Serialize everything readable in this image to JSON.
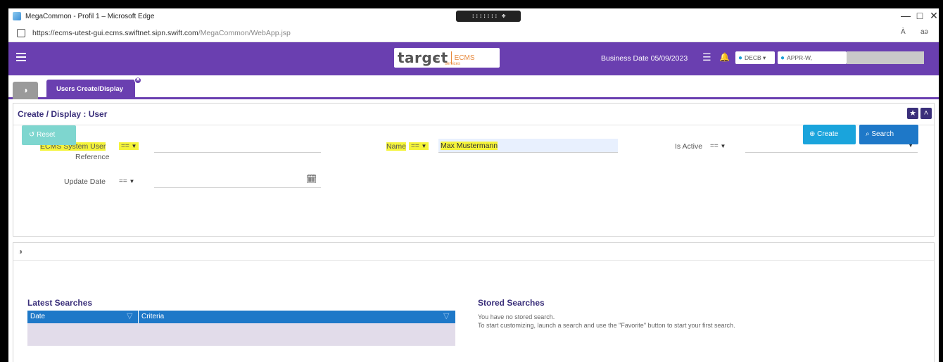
{
  "browser": {
    "title": "MegaCommon - Profil 1 – Microsoft Edge",
    "drag_handle": "::::::: ✥ :::::::",
    "url_host": "https://ecms-utest-gui.ecms.swiftnet.sipn.swift.com",
    "url_path": "/MegaCommon/WebApp.jsp",
    "minimize": "—",
    "maximize": "□",
    "close": "✕",
    "read_aloud": "À",
    "immersive": "aə"
  },
  "header": {
    "logo_word": "targєt",
    "logo_sub": "services",
    "logo_ecms": "ECMS",
    "business_date": "Business Date 05/09/2023",
    "list_icon": "☰",
    "bell_icon": "🔔",
    "user_icon": "⬤",
    "entity_pill": "DECB ▾",
    "user_pill": "APPR-W,"
  },
  "tabs": {
    "home_icon": "◑",
    "active_label": "Users Create/Display",
    "close_glyph": "✖"
  },
  "panel": {
    "title": "Create / Display : User",
    "star_icon": "★",
    "collapse_icon": "˄",
    "fields": {
      "ecms_ref_label": "ECMS System User",
      "ecms_ref_label2": "Reference",
      "ecms_ref_op": "==",
      "name_label": "Name",
      "name_op": "==",
      "name_value": "Max Mustermann",
      "is_active_label": "Is Active",
      "is_active_op": "==",
      "update_date_label": "Update Date",
      "update_date_op": "==",
      "calendar_icon": "🗓",
      "caret": "▼"
    },
    "buttons": {
      "reset": "Reset",
      "reset_icon": "↺",
      "create": "Create",
      "create_icon": "⊕",
      "search": "Search",
      "search_icon": "⌕"
    }
  },
  "lower": {
    "section_icon": "◑",
    "latest_title": "Latest Searches",
    "columns": [
      "Date",
      "Criteria"
    ],
    "filter_icon": "▽",
    "stored_title": "Stored Searches",
    "stored_line1": "You have no stored search.",
    "stored_line2": "To start customizing, launch a search and use the \"Favorite\" button to start your first search."
  },
  "colors": {
    "brand_purple": "#6a3fb0",
    "dark_purple": "#3a2f7a",
    "create_blue": "#1aa4dc",
    "search_blue": "#1e78c8",
    "reset_teal": "#7ed6cf",
    "highlight": "#f5f43a"
  }
}
